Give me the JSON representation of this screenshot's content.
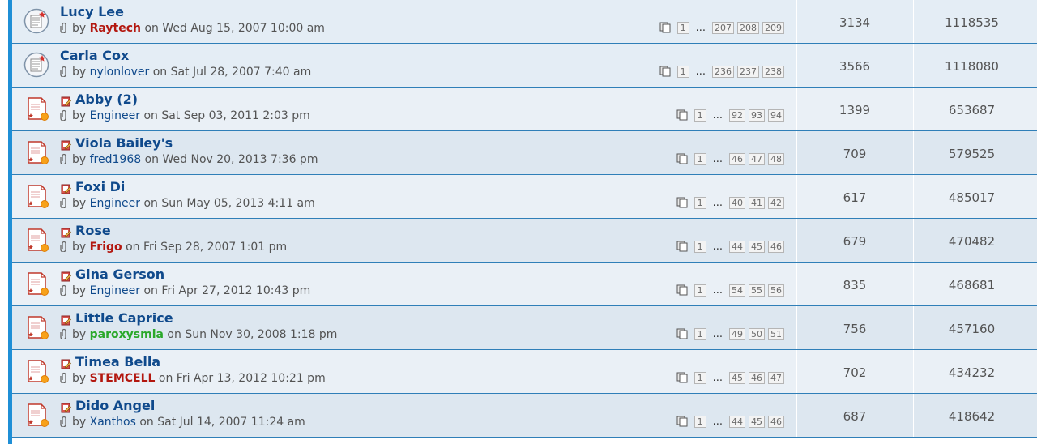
{
  "topics": [
    {
      "title": "Lucy Lee",
      "type": "sticky",
      "by": "by",
      "author": "Raytech",
      "author_style": "red",
      "on": "on",
      "date": "Wed Aug 15, 2007 10:00 am",
      "pages": [
        "1",
        "...",
        "207",
        "208",
        "209"
      ],
      "replies": "3134",
      "views": "1118535"
    },
    {
      "title": "Carla Cox",
      "type": "sticky",
      "by": "by",
      "author": "nylonlover",
      "author_style": "normal",
      "on": "on",
      "date": "Sat Jul 28, 2007 7:40 am",
      "pages": [
        "1",
        "...",
        "236",
        "237",
        "238"
      ],
      "replies": "3566",
      "views": "1118080"
    },
    {
      "title": "Abby (2)",
      "type": "hot",
      "by": "by",
      "author": "Engineer",
      "author_style": "normal",
      "on": "on",
      "date": "Sat Sep 03, 2011 2:03 pm",
      "pages": [
        "1",
        "...",
        "92",
        "93",
        "94"
      ],
      "replies": "1399",
      "views": "653687"
    },
    {
      "title": "Viola Bailey's",
      "type": "hot",
      "by": "by",
      "author": "fred1968",
      "author_style": "normal",
      "on": "on",
      "date": "Wed Nov 20, 2013 7:36 pm",
      "pages": [
        "1",
        "...",
        "46",
        "47",
        "48"
      ],
      "replies": "709",
      "views": "579525"
    },
    {
      "title": "Foxi Di",
      "type": "hot",
      "by": "by",
      "author": "Engineer",
      "author_style": "normal",
      "on": "on",
      "date": "Sun May 05, 2013 4:11 am",
      "pages": [
        "1",
        "...",
        "40",
        "41",
        "42"
      ],
      "replies": "617",
      "views": "485017"
    },
    {
      "title": "Rose",
      "type": "hot",
      "by": "by",
      "author": "Frigo",
      "author_style": "red",
      "on": "on",
      "date": "Fri Sep 28, 2007 1:01 pm",
      "pages": [
        "1",
        "...",
        "44",
        "45",
        "46"
      ],
      "replies": "679",
      "views": "470482"
    },
    {
      "title": "Gina Gerson",
      "type": "hot",
      "by": "by",
      "author": "Engineer",
      "author_style": "normal",
      "on": "on",
      "date": "Fri Apr 27, 2012 10:43 pm",
      "pages": [
        "1",
        "...",
        "54",
        "55",
        "56"
      ],
      "replies": "835",
      "views": "468681"
    },
    {
      "title": "Little Caprice",
      "type": "hot",
      "by": "by",
      "author": "paroxysmia",
      "author_style": "green",
      "on": "on",
      "date": "Sun Nov 30, 2008 1:18 pm",
      "pages": [
        "1",
        "...",
        "49",
        "50",
        "51"
      ],
      "replies": "756",
      "views": "457160"
    },
    {
      "title": "Timea Bella",
      "type": "hot",
      "by": "by",
      "author": "STEMCELL",
      "author_style": "red",
      "on": "on",
      "date": "Fri Apr 13, 2012 10:21 pm",
      "pages": [
        "1",
        "...",
        "45",
        "46",
        "47"
      ],
      "replies": "702",
      "views": "434232"
    },
    {
      "title": "Dido Angel",
      "type": "hot",
      "by": "by",
      "author": "Xanthos",
      "author_style": "normal",
      "on": "on",
      "date": "Sat Jul 14, 2007 11:24 am",
      "pages": [
        "1",
        "...",
        "44",
        "45",
        "46"
      ],
      "replies": "687",
      "views": "418642"
    }
  ],
  "icons": {
    "sticky": "sticky-topic-icon",
    "hot": "hot-topic-icon",
    "attachment": "paperclip-icon",
    "pages": "pages-icon",
    "title_icon": "edit-icon"
  },
  "colors": {
    "accent": "#1f8fd6",
    "title": "#104a8c",
    "author_red": "#b3170f",
    "author_green": "#2aa82a"
  }
}
